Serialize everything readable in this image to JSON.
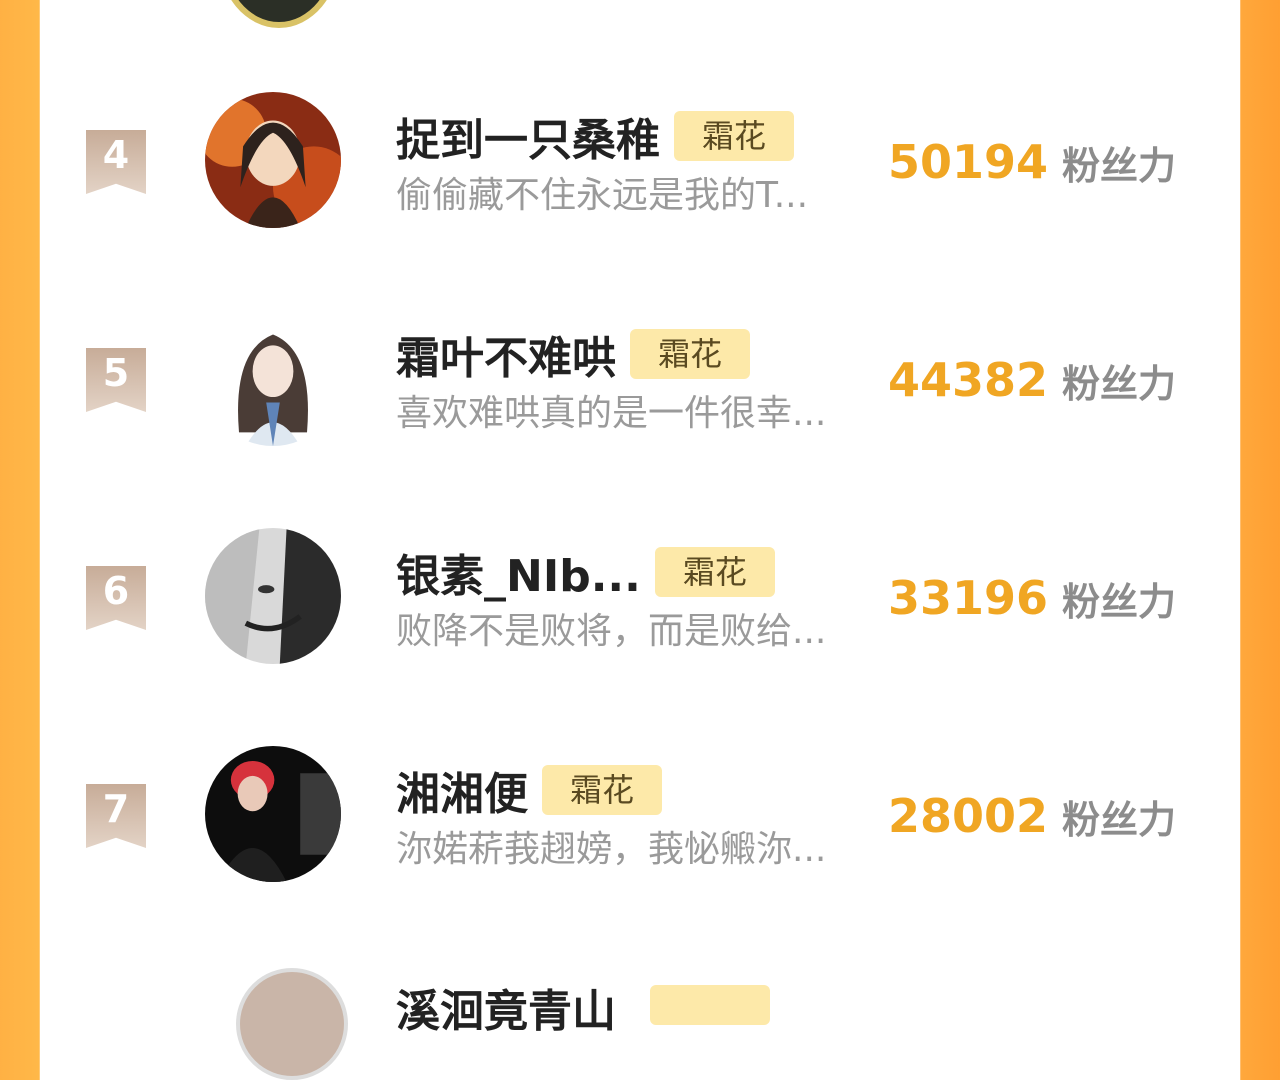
{
  "leaderboard": {
    "score_unit": "粉丝力",
    "rows": [
      {
        "rank": "4",
        "name": "捉到一只桑稚",
        "tag": "霜花",
        "sign": "偷偷藏不住永远是我的T...",
        "score": "50194"
      },
      {
        "rank": "5",
        "name": "霜叶不难哄",
        "tag": "霜花",
        "sign": "喜欢难哄真的是一件很幸...",
        "score": "44382"
      },
      {
        "rank": "6",
        "name": "银素_NIb...",
        "tag": "霜花",
        "sign": "败降不是败将，而是败给...",
        "score": "33196"
      },
      {
        "rank": "7",
        "name": "湘湘便",
        "tag": "霜花",
        "sign": "沵婼菥莪趐嫎，莪怭毈沵...",
        "score": "28002"
      }
    ],
    "partial_next_name": "溪洄竟青山"
  },
  "colors": {
    "accent": "#f0a623",
    "tag_bg": "#fde9a9",
    "rank_bg": "#d4bfae",
    "side_gradient": "#ffa83c"
  },
  "icons": [
    "rank-ribbon-icon"
  ]
}
